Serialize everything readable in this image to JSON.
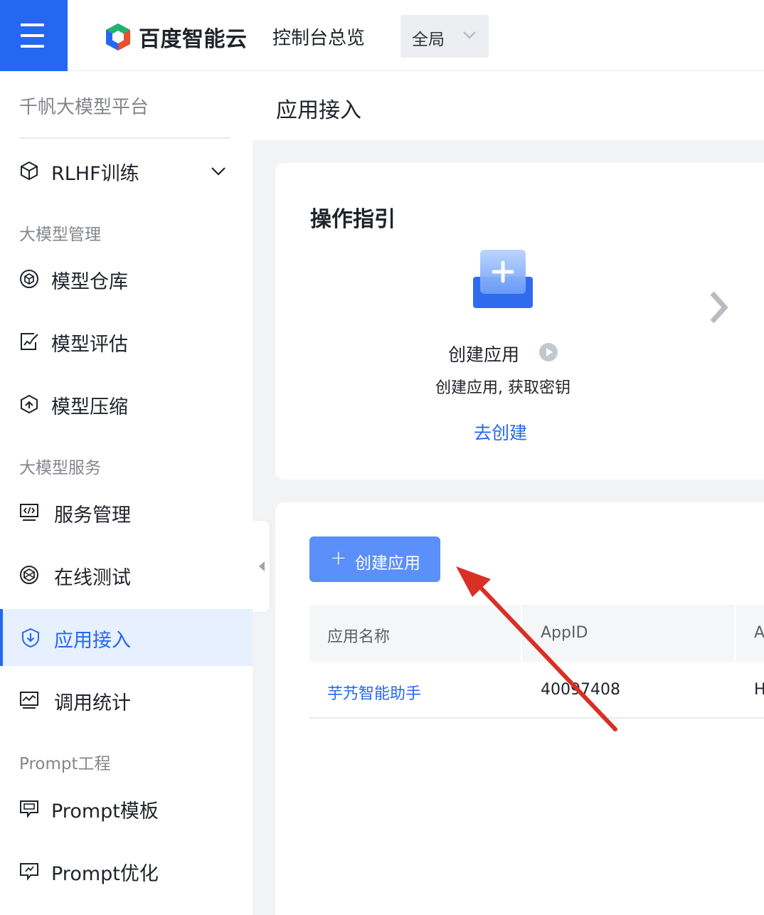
{
  "topbar": {
    "brand": "百度智能云",
    "console_title": "控制台总览",
    "region": {
      "selected": "全局"
    }
  },
  "sidebar": {
    "title": "千帆大模型平台",
    "rlhf": {
      "label": "RLHF训练"
    },
    "groups": {
      "model_mgmt": "大模型管理",
      "model_service": "大模型服务",
      "prompt_eng": "Prompt工程"
    },
    "items": {
      "model_repo": "模型仓库",
      "model_eval": "模型评估",
      "model_compress": "模型压缩",
      "service_mgmt": "服务管理",
      "online_test": "在线测试",
      "app_access": "应用接入",
      "call_stats": "调用统计",
      "prompt_template": "Prompt模板",
      "prompt_optimize": "Prompt优化"
    },
    "active_item": "应用接入"
  },
  "page": {
    "title": "应用接入"
  },
  "guide": {
    "title": "操作指引",
    "step_title": "创建应用",
    "step_desc": "创建应用, 获取密钥",
    "step_link": "去创建"
  },
  "app_list": {
    "create_button": "创建应用",
    "columns": [
      "应用名称",
      "AppID",
      "A"
    ],
    "rows": [
      {
        "name": "芋艿智能助手",
        "app_id": "40097408",
        "col3": "H"
      }
    ]
  },
  "colors": {
    "primary": "#2468f2",
    "button": "#5b8ff9",
    "annotation_arrow": "#d93026"
  }
}
